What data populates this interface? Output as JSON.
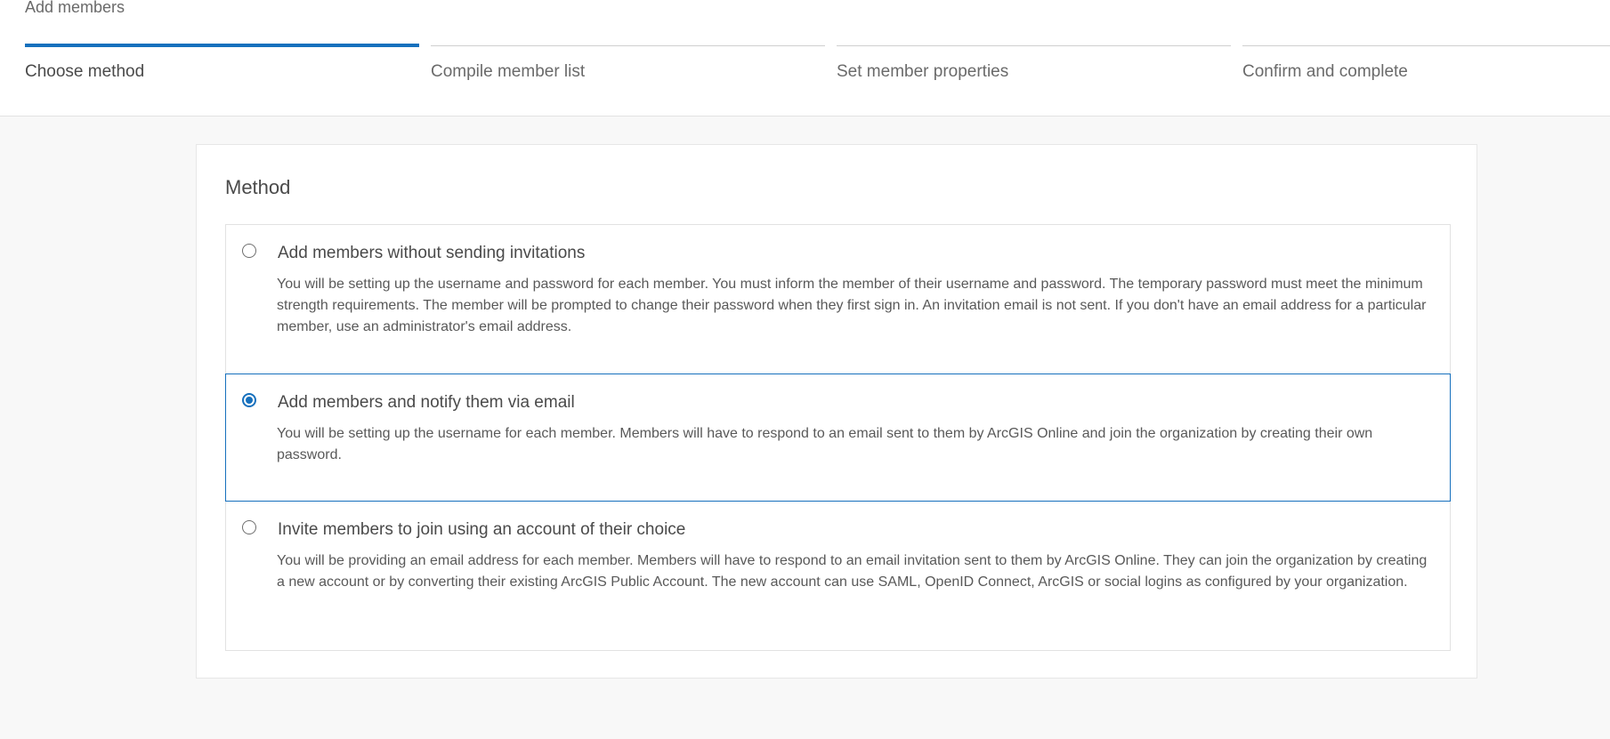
{
  "page": {
    "title": "Add members"
  },
  "steps": [
    {
      "label": "Choose method",
      "active": true
    },
    {
      "label": "Compile member list",
      "active": false
    },
    {
      "label": "Set member properties",
      "active": false
    },
    {
      "label": "Confirm and complete",
      "active": false
    }
  ],
  "method": {
    "title": "Method",
    "options": [
      {
        "title": "Add members without sending invitations",
        "description": "You will be setting up the username and password for each member. You must inform the member of their username and password. The temporary password must meet the minimum strength requirements. The member will be prompted to change their password when they first sign in. An invitation email is not sent. If you don't have an email address for a particular member, use an administrator's email address.",
        "selected": false
      },
      {
        "title": "Add members and notify them via email",
        "description": "You will be setting up the username for each member. Members will have to respond to an email sent to them by ArcGIS Online and join the organization by creating their own password.",
        "selected": true
      },
      {
        "title": "Invite members to join using an account of their choice",
        "description": "You will be providing an email address for each member. Members will have to respond to an email invitation sent to them by ArcGIS Online. They can join the organization by creating a new account or by converting their existing ArcGIS Public Account. The new account can use SAML, OpenID Connect, ArcGIS or social logins as configured by your organization.",
        "selected": false
      }
    ]
  },
  "colors": {
    "accent": "#1670bd",
    "background": "#f8f8f8",
    "card": "#ffffff"
  }
}
